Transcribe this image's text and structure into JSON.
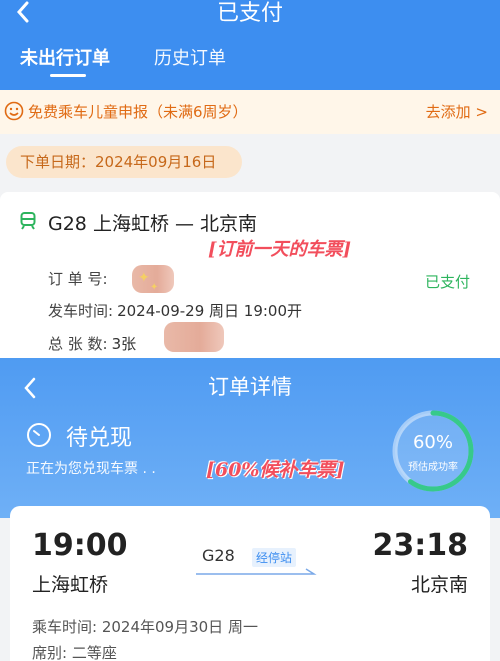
{
  "top": {
    "title": "已支付",
    "tabs": [
      "未出行订单",
      "历史订单"
    ],
    "child_banner": {
      "text": "免费乘车儿童申报（未满6周岁）",
      "action": "去添加 >"
    },
    "order_date": "下单日期：2024年09月16日",
    "order": {
      "route": "G28  上海虹桥 — 北京南",
      "annotation": "[订前一天的车票]",
      "order_no_label": "订 单 号:",
      "status": "已支付",
      "departure_label": "发车时间:",
      "departure_value": "2024-09-29  周日  19:00开",
      "count_label": "总 张 数:",
      "count_value": "3张"
    }
  },
  "bottom": {
    "title": "订单详情",
    "status": "待兑现",
    "status_sub": "正在为您兑现车票 . .",
    "annotation": "[60%候补车票]",
    "gauge": {
      "percent": "60%",
      "label": "预估成功率",
      "value": 0.6
    },
    "trip": {
      "departure_time": "19:00",
      "arrival_time": "23:18",
      "departure_station": "上海虹桥",
      "arrival_station": "北京南",
      "train_no": "G28",
      "stops_link": "经停站",
      "ride_time": "乘车时间: 2024年09月30日 周一",
      "seat": "席别: 二等座"
    }
  },
  "colors": {
    "primary": "#3d8ef0",
    "orange": "#e06b14",
    "paid_green": "#2db45d",
    "annotation_red": "#f24e5c"
  },
  "icons": [
    "back-icon",
    "smile-icon",
    "train-icon",
    "clock-icon",
    "chevron-right-icon"
  ]
}
